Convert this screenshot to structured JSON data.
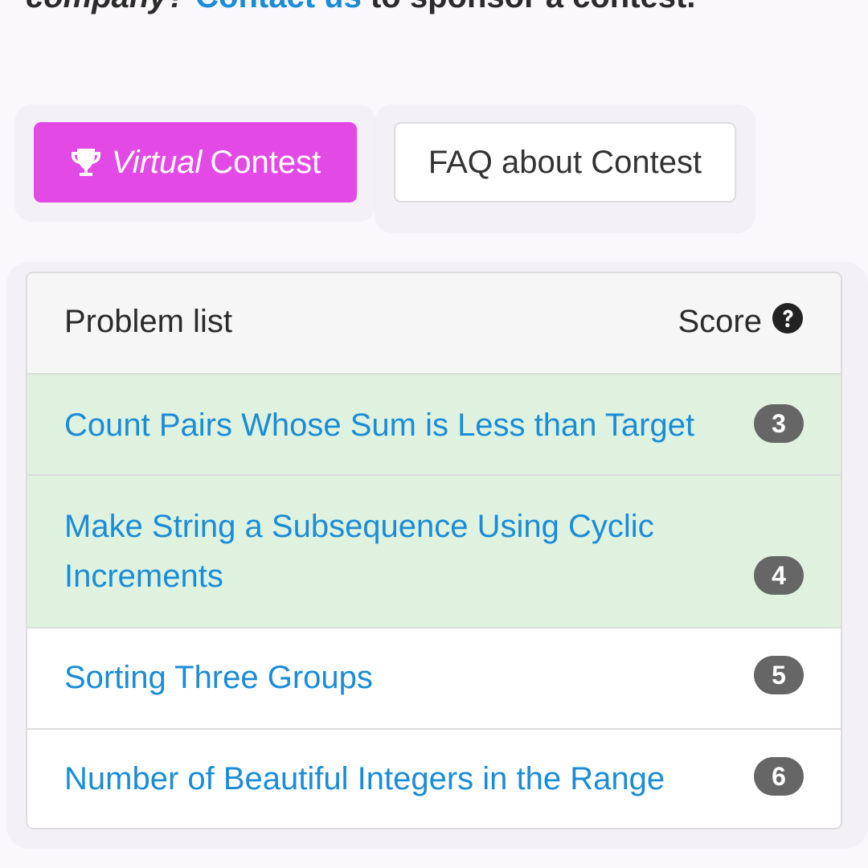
{
  "sponsor": {
    "company": "company",
    "punct": "?",
    "contact_link": "Contact us",
    "rest": "to sponsor a contest."
  },
  "buttons": {
    "virtual_italic": "Virtual",
    "virtual_rest": "Contest",
    "faq": "FAQ about Contest"
  },
  "problem_list": {
    "title": "Problem list",
    "score_label": "Score",
    "items": [
      {
        "name": "Count Pairs Whose Sum is Less than Target",
        "score": "3",
        "solved": true
      },
      {
        "name": "Make String a Subsequence Using Cyclic Increments",
        "score": "4",
        "solved": true
      },
      {
        "name": "Sorting Three Groups",
        "score": "5",
        "solved": false
      },
      {
        "name": "Number of Beautiful Integers in the Range",
        "score": "6",
        "solved": false
      }
    ]
  },
  "colors": {
    "accent": "#e349e5",
    "link": "#1a8cd8",
    "solved_row": "#dff2df",
    "badge": "#666666"
  }
}
